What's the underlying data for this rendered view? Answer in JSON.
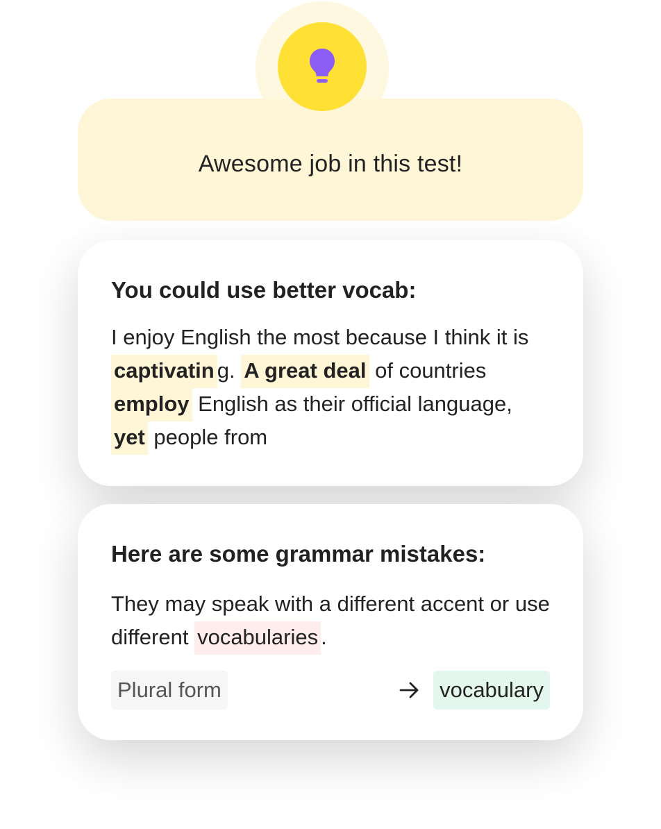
{
  "banner": {
    "icon": "lightbulb-icon",
    "message": "Awesome job in this test!"
  },
  "vocab_card": {
    "title": "You could use better vocab:",
    "text": {
      "t0": "I enjoy English the most because I think it is ",
      "h1": "captivatin",
      "t1": "g. ",
      "h2": "A great deal",
      "t2": " of countries ",
      "h3": "employ",
      "t3": " English as their official language, ",
      "h4": "yet",
      "t4": " people from"
    }
  },
  "grammar_card": {
    "title": "Here are some grammar mistakes:",
    "text": {
      "t0": "They may speak with a different accent or use different ",
      "error": "vocabularies",
      "t1": "."
    },
    "rule_label": "Plural form",
    "arrow_icon": "arrow-right-icon",
    "suggestion": "vocabulary"
  },
  "colors": {
    "accent_yellow": "#ffe135",
    "banner_bg": "#fff6d8",
    "bulb_purple": "#8b5cf6",
    "error_bg": "#ffecec",
    "suggestion_bg": "#e3f7ee"
  }
}
